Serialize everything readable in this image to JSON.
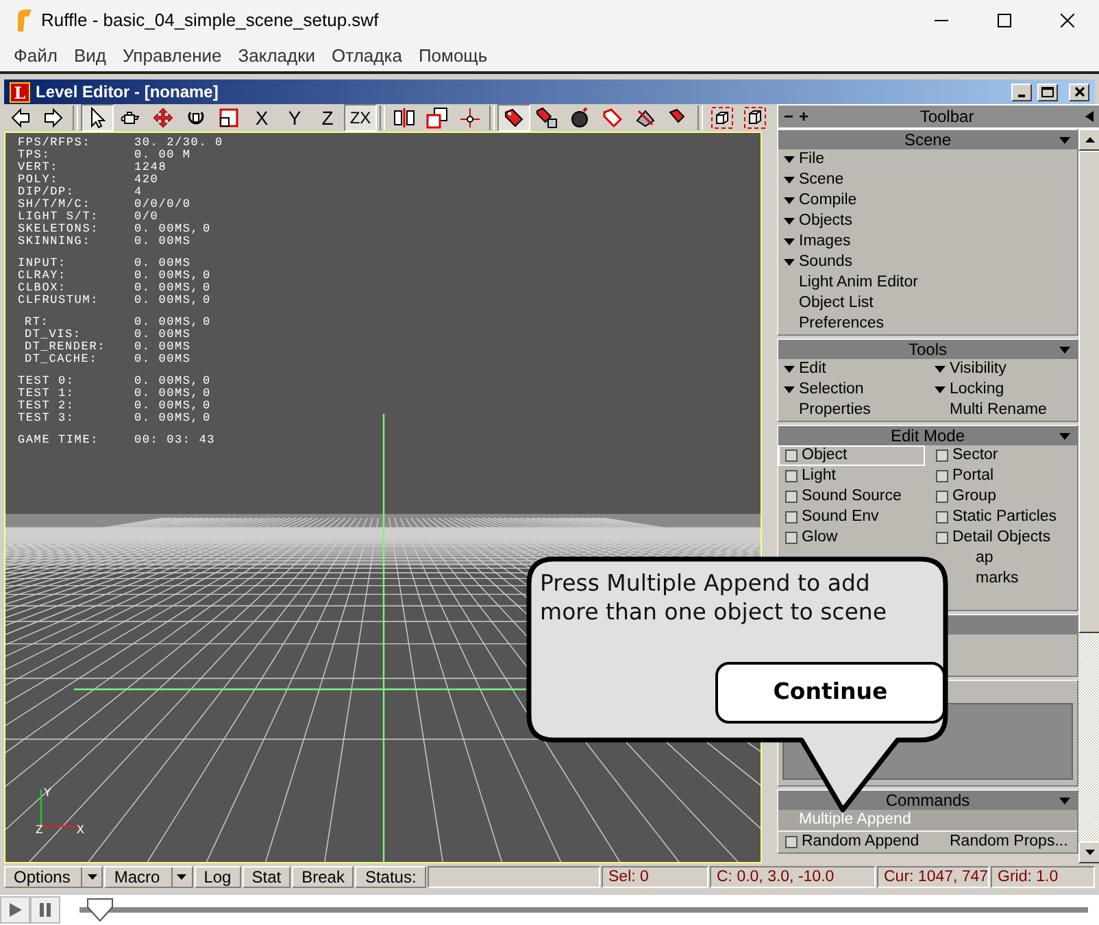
{
  "window": {
    "title": "Ruffle - basic_04_simple_scene_setup.swf"
  },
  "menu": [
    "Файл",
    "Вид",
    "Управление",
    "Закладки",
    "Отладка",
    "Помощь"
  ],
  "editor": {
    "icon_letter": "L",
    "title": "Level Editor - [noname]"
  },
  "toolbar": [
    {
      "kind": "icon",
      "selected": false
    },
    {
      "kind": "icon",
      "selected": false
    },
    {
      "kind": "separator"
    },
    {
      "kind": "icon",
      "selected": true
    },
    {
      "kind": "icon",
      "selected": false
    },
    {
      "kind": "icon",
      "selected": false
    },
    {
      "kind": "icon",
      "selected": false
    },
    {
      "kind": "icon",
      "selected": false
    },
    {
      "kind": "text",
      "label": "X",
      "selected": false
    },
    {
      "kind": "text",
      "label": "Y",
      "selected": false
    },
    {
      "kind": "text",
      "label": "Z",
      "selected": false
    },
    {
      "kind": "text",
      "label": "ZX",
      "selected": true
    },
    {
      "kind": "separator"
    },
    {
      "kind": "icon",
      "selected": false
    },
    {
      "kind": "icon",
      "selected": false
    },
    {
      "kind": "icon",
      "selected": false
    },
    {
      "kind": "separator"
    },
    {
      "kind": "icon",
      "selected": true
    },
    {
      "kind": "icon",
      "selected": false
    },
    {
      "kind": "icon",
      "selected": false
    },
    {
      "kind": "icon",
      "selected": false
    },
    {
      "kind": "icon",
      "selected": false
    },
    {
      "kind": "icon",
      "selected": false
    },
    {
      "kind": "separator"
    },
    {
      "kind": "icon",
      "selected": false
    },
    {
      "kind": "icon",
      "selected": false
    }
  ],
  "stats": [
    {
      "indent": false,
      "rows": [
        {
          "label": "FPS/RFPS:",
          "value": "30. 2/30. 0"
        },
        {
          "label": "TPS:",
          "value": "0. 00 M"
        },
        {
          "label": "VERT:",
          "value": "1248"
        },
        {
          "label": "POLY:",
          "value": "420"
        },
        {
          "label": "DIP/DP:",
          "value": "4"
        },
        {
          "label": "SH/T/M/C:",
          "value": "0/0/0/0"
        },
        {
          "label": "LIGHT S/T:",
          "value": "0/0"
        },
        {
          "label": "SKELETONS:",
          "value": "0. 00MS,",
          "count": "0"
        },
        {
          "label": "SKINNING:",
          "value": "0. 00MS"
        }
      ]
    },
    {
      "indent": false,
      "rows": [
        {
          "label": "INPUT:",
          "value": "0. 00MS"
        },
        {
          "label": "CLRAY:",
          "value": "0. 00MS,",
          "count": "0"
        },
        {
          "label": "CLBOX:",
          "value": "0. 00MS,",
          "count": "0"
        },
        {
          "label": "CLFRUSTUM:",
          "value": "0. 00MS,",
          "count": "0"
        }
      ]
    },
    {
      "indent": true,
      "rows": [
        {
          "label": "RT:",
          "value": "0. 00MS,",
          "count": "0"
        },
        {
          "label": "DT_VIS:",
          "value": "0. 00MS"
        },
        {
          "label": "DT_RENDER:",
          "value": "0. 00MS"
        },
        {
          "label": "DT_CACHE:",
          "value": "0. 00MS"
        }
      ]
    },
    {
      "indent": false,
      "rows": [
        {
          "label": "TEST 0:",
          "value": "0. 00MS,",
          "count": "0"
        },
        {
          "label": "TEST 1:",
          "value": "0. 00MS,",
          "count": "0"
        },
        {
          "label": "TEST 2:",
          "value": "0. 00MS,",
          "count": "0"
        },
        {
          "label": "TEST 3:",
          "value": "0. 00MS,",
          "count": "0"
        }
      ]
    },
    {
      "indent": false,
      "rows": [
        {
          "label": "GAME TIME:",
          "value": "00: 03: 43"
        }
      ]
    }
  ],
  "axis_labels": {
    "y": "Y",
    "z": "Z",
    "x": "X"
  },
  "side_panel": {
    "collapse": "−",
    "expand": "+",
    "title": "Toolbar",
    "sections": [
      {
        "kind": "rows",
        "title": "Scene",
        "rows": [
          {
            "left": {
              "kind": "expander",
              "label": "File"
            }
          },
          {
            "left": {
              "kind": "expander",
              "label": "Scene"
            }
          },
          {
            "left": {
              "kind": "expander",
              "label": "Compile"
            }
          },
          {
            "left": {
              "kind": "expander",
              "label": "Objects"
            }
          },
          {
            "left": {
              "kind": "expander",
              "label": "Images"
            }
          },
          {
            "left": {
              "kind": "expander",
              "label": "Sounds"
            }
          },
          {
            "left": {
              "kind": "link",
              "label": "Light Anim Editor"
            }
          },
          {
            "left": {
              "kind": "link",
              "label": "Object List"
            }
          },
          {
            "left": {
              "kind": "link",
              "label": "Preferences"
            }
          }
        ]
      },
      {
        "kind": "rows",
        "title": "Tools",
        "rows": [
          {
            "left": {
              "kind": "expander",
              "label": "Edit"
            },
            "right": {
              "kind": "expander",
              "label": "Visibility"
            }
          },
          {
            "left": {
              "kind": "expander",
              "label": "Selection"
            },
            "right": {
              "kind": "expander",
              "label": "Locking"
            }
          },
          {
            "left": {
              "kind": "link",
              "label": "Properties"
            },
            "right": {
              "kind": "link",
              "label": "Multi Rename"
            }
          }
        ]
      },
      {
        "kind": "rows",
        "title": "Edit Mode",
        "rows": [
          {
            "left": {
              "kind": "check",
              "label": "Object",
              "checked": false,
              "selected": true
            },
            "right": {
              "kind": "check",
              "label": "Sector",
              "checked": false,
              "selected": false
            }
          },
          {
            "left": {
              "kind": "check",
              "label": "Light",
              "checked": false,
              "selected": false
            },
            "right": {
              "kind": "check",
              "label": "Portal",
              "checked": false,
              "selected": false
            }
          },
          {
            "left": {
              "kind": "check",
              "label": "Sound Source",
              "checked": false,
              "selected": false
            },
            "right": {
              "kind": "check",
              "label": "Group",
              "checked": false,
              "selected": false
            }
          },
          {
            "left": {
              "kind": "check",
              "label": "Sound Env",
              "checked": false,
              "selected": false
            },
            "right": {
              "kind": "check",
              "label": "Static Particles",
              "checked": false,
              "selected": false
            }
          },
          {
            "left": {
              "kind": "check",
              "label": "Glow",
              "checked": false,
              "selected": false
            },
            "right": {
              "kind": "check",
              "label": "Detail Objects",
              "checked": false,
              "selected": false
            }
          },
          {
            "right": {
              "kind": "partial",
              "label": "ap"
            }
          },
          {
            "right": {
              "kind": "partial",
              "label": "marks"
            }
          },
          {}
        ]
      },
      {
        "kind": "empty"
      },
      {
        "kind": "well"
      },
      {
        "kind": "rows",
        "title": "Commands",
        "rows": [
          {
            "left": {
              "kind": "link",
              "label": "Multiple Append",
              "highlighted": true
            }
          },
          {
            "rule": true,
            "left": {
              "kind": "check",
              "label": "Random Append",
              "checked": false,
              "selected": false
            },
            "right": {
              "kind": "link",
              "label": "Random Props..."
            }
          }
        ]
      }
    ]
  },
  "status_bar": {
    "buttons": [
      {
        "label": "Options",
        "dropdown": true
      },
      {
        "label": "Macro",
        "dropdown": true
      },
      {
        "label": "Log",
        "dropdown": false
      },
      {
        "label": "Stat",
        "dropdown": false
      },
      {
        "label": "Break",
        "dropdown": false
      },
      {
        "label": "Status:",
        "dropdown": false
      }
    ],
    "readouts": [
      "Sel: 0",
      "C: 0.0, 3.0, -10.0",
      "Cur: 1047, 747",
      "Grid: 1.0"
    ]
  },
  "player": {
    "level": 0.02
  },
  "tutorial": {
    "message": "Press Multiple Append to add more than one object to scene",
    "button": "Continue"
  }
}
